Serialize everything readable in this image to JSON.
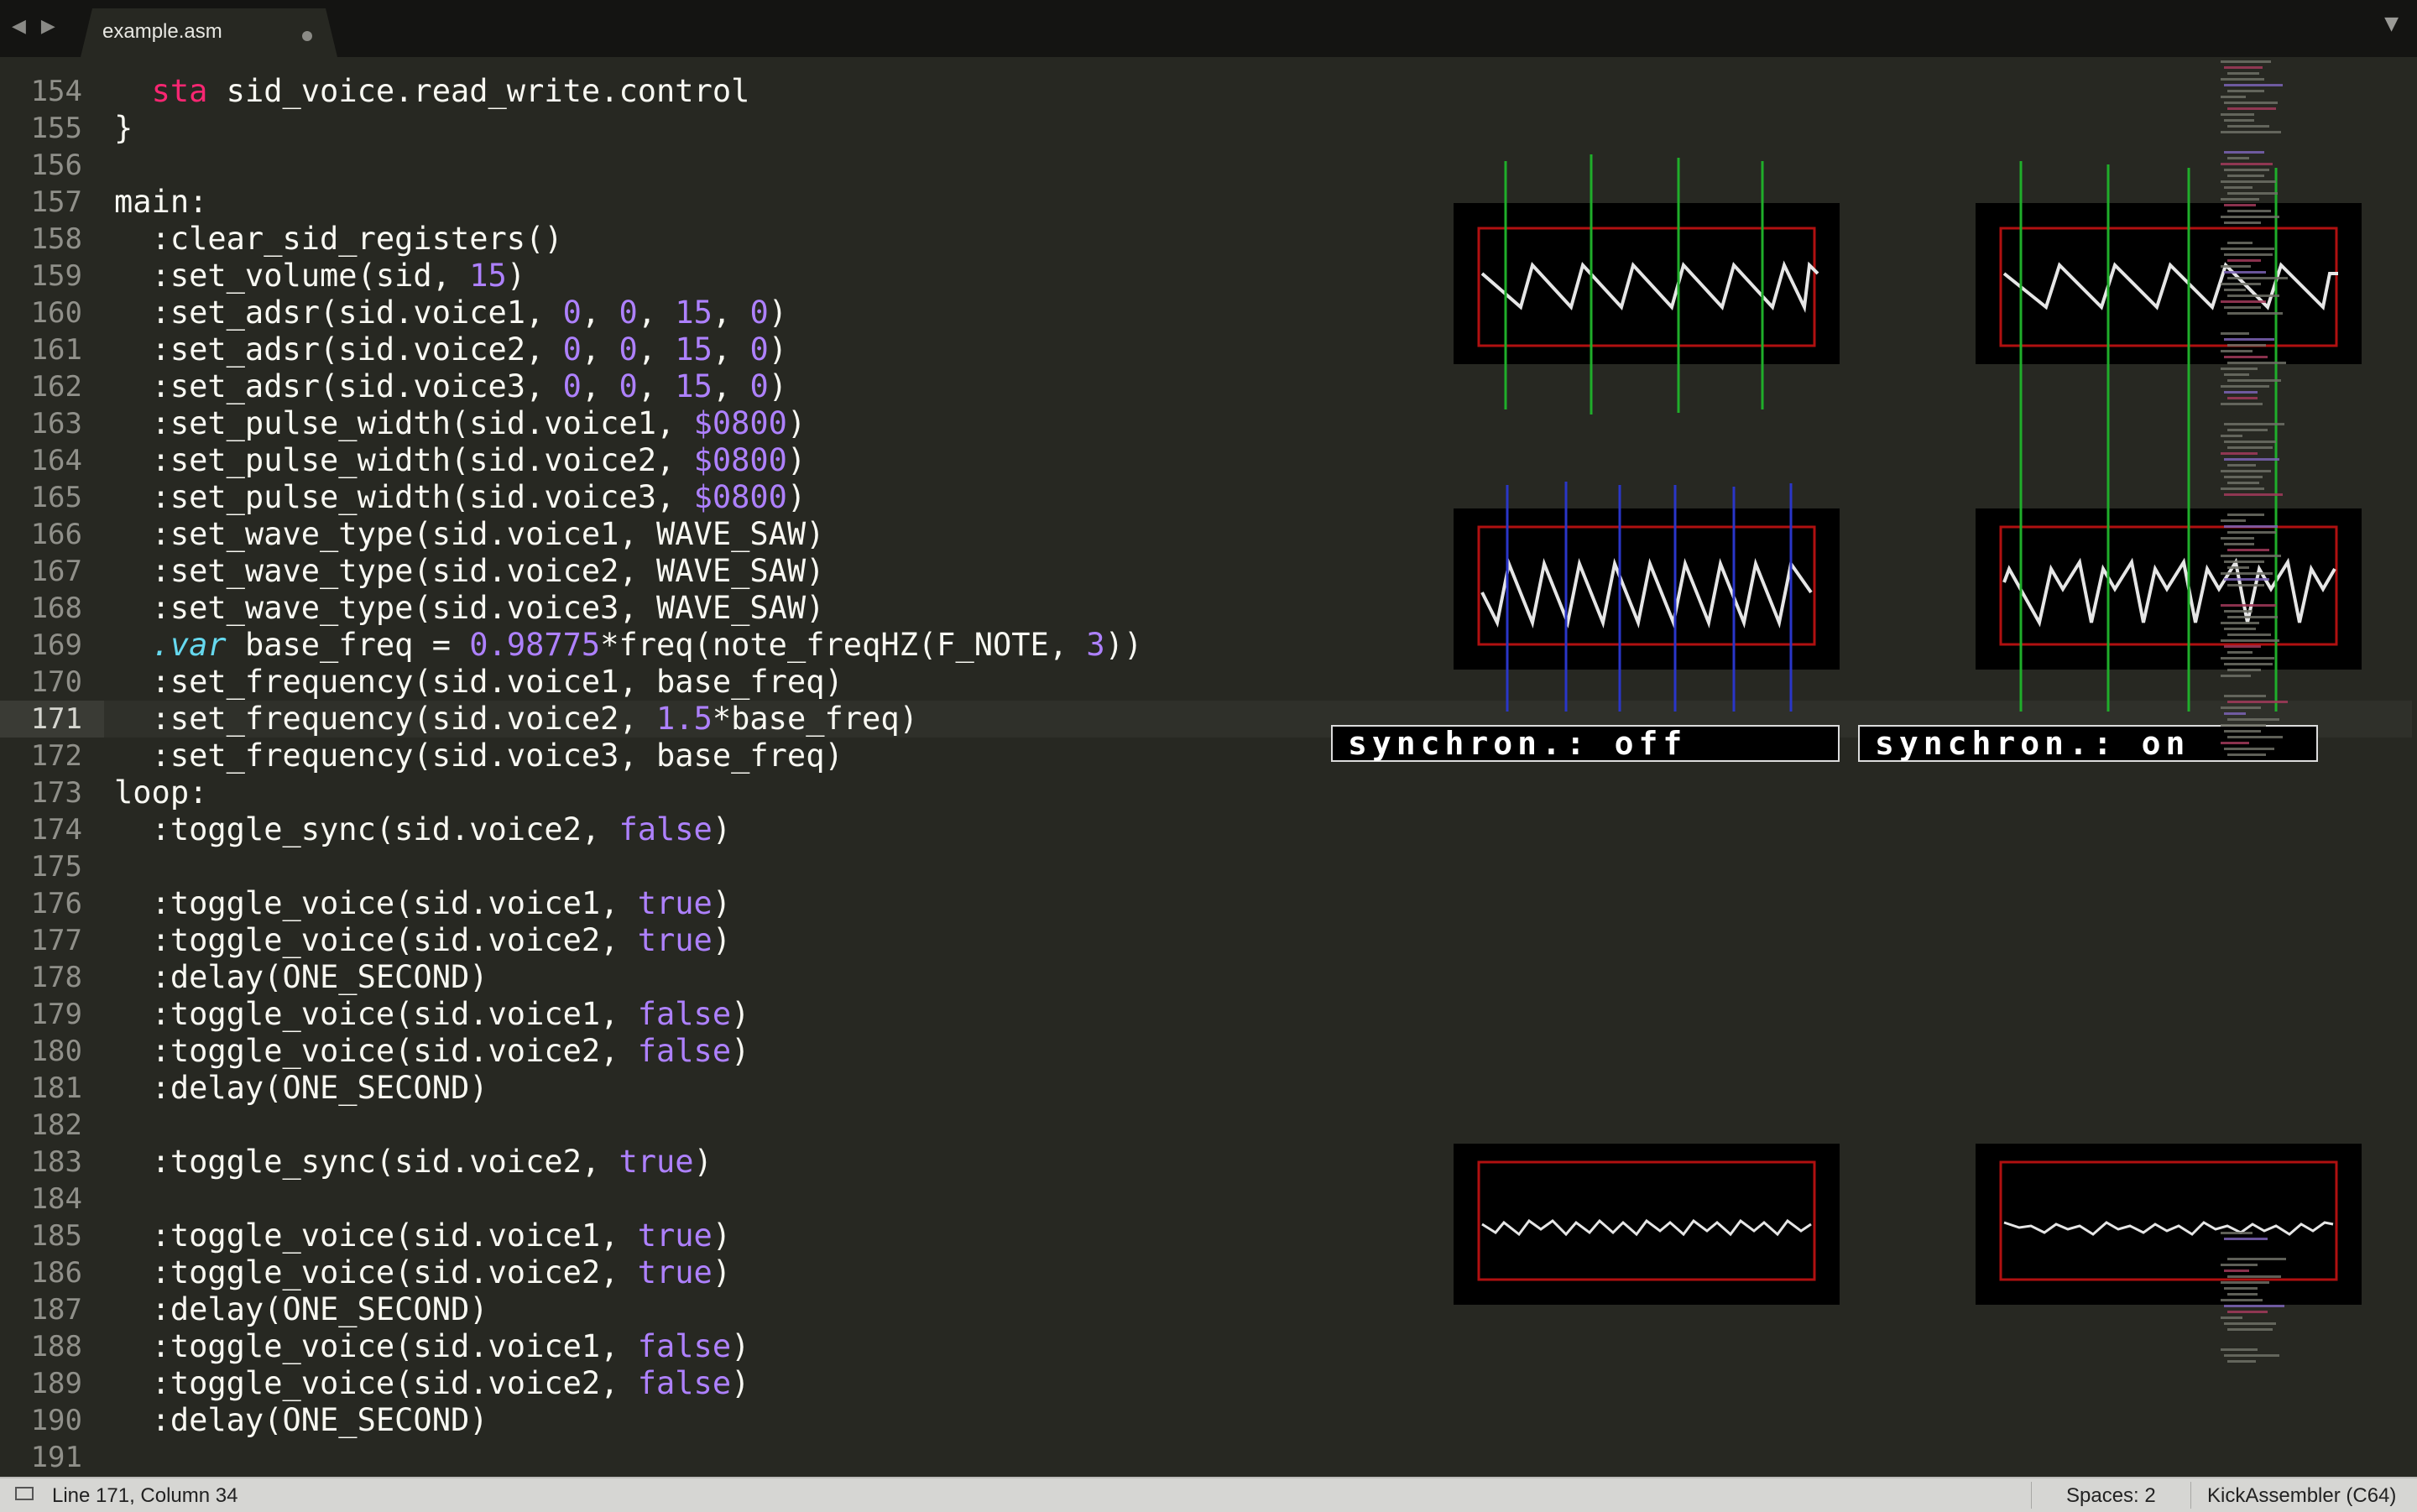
{
  "tab": {
    "title": "example.asm"
  },
  "nav": {
    "back": "◀",
    "forward": "▶",
    "menu": "▼"
  },
  "editor": {
    "lines": [
      {
        "n": "154",
        "segments": [
          {
            "t": "  "
          },
          {
            "t": "sta",
            "c": "k-red"
          },
          {
            "t": " sid_voice.read_write.control"
          }
        ]
      },
      {
        "n": "155",
        "segments": [
          {
            "t": "}"
          }
        ]
      },
      {
        "n": "156",
        "segments": [
          {
            "t": ""
          }
        ]
      },
      {
        "n": "157",
        "segments": [
          {
            "t": "main:"
          }
        ]
      },
      {
        "n": "158",
        "segments": [
          {
            "t": "  :clear_sid_registers()"
          }
        ]
      },
      {
        "n": "159",
        "segments": [
          {
            "t": "  :set_volume(sid, "
          },
          {
            "t": "15",
            "c": "k-num"
          },
          {
            "t": ")"
          }
        ]
      },
      {
        "n": "160",
        "segments": [
          {
            "t": "  :set_adsr(sid.voice1, "
          },
          {
            "t": "0",
            "c": "k-num"
          },
          {
            "t": ", "
          },
          {
            "t": "0",
            "c": "k-num"
          },
          {
            "t": ", "
          },
          {
            "t": "15",
            "c": "k-num"
          },
          {
            "t": ", "
          },
          {
            "t": "0",
            "c": "k-num"
          },
          {
            "t": ")"
          }
        ]
      },
      {
        "n": "161",
        "segments": [
          {
            "t": "  :set_adsr(sid.voice2, "
          },
          {
            "t": "0",
            "c": "k-num"
          },
          {
            "t": ", "
          },
          {
            "t": "0",
            "c": "k-num"
          },
          {
            "t": ", "
          },
          {
            "t": "15",
            "c": "k-num"
          },
          {
            "t": ", "
          },
          {
            "t": "0",
            "c": "k-num"
          },
          {
            "t": ")"
          }
        ]
      },
      {
        "n": "162",
        "segments": [
          {
            "t": "  :set_adsr(sid.voice3, "
          },
          {
            "t": "0",
            "c": "k-num"
          },
          {
            "t": ", "
          },
          {
            "t": "0",
            "c": "k-num"
          },
          {
            "t": ", "
          },
          {
            "t": "15",
            "c": "k-num"
          },
          {
            "t": ", "
          },
          {
            "t": "0",
            "c": "k-num"
          },
          {
            "t": ")"
          }
        ]
      },
      {
        "n": "163",
        "segments": [
          {
            "t": "  :set_pulse_width(sid.voice1, "
          },
          {
            "t": "$0800",
            "c": "k-num"
          },
          {
            "t": ")"
          }
        ]
      },
      {
        "n": "164",
        "segments": [
          {
            "t": "  :set_pulse_width(sid.voice2, "
          },
          {
            "t": "$0800",
            "c": "k-num"
          },
          {
            "t": ")"
          }
        ]
      },
      {
        "n": "165",
        "segments": [
          {
            "t": "  :set_pulse_width(sid.voice3, "
          },
          {
            "t": "$0800",
            "c": "k-num"
          },
          {
            "t": ")"
          }
        ]
      },
      {
        "n": "166",
        "segments": [
          {
            "t": "  :set_wave_type(sid.voice1, WAVE_SAW)"
          }
        ]
      },
      {
        "n": "167",
        "segments": [
          {
            "t": "  :set_wave_type(sid.voice2, WAVE_SAW)"
          }
        ]
      },
      {
        "n": "168",
        "segments": [
          {
            "t": "  :set_wave_type(sid.voice3, WAVE_SAW)"
          }
        ]
      },
      {
        "n": "169",
        "segments": [
          {
            "t": "  "
          },
          {
            "t": ".var",
            "c": "k-blue"
          },
          {
            "t": " base_freq = "
          },
          {
            "t": "0.98775",
            "c": "k-num"
          },
          {
            "t": "*freq(note_freqHZ(F_NOTE, "
          },
          {
            "t": "3",
            "c": "k-num"
          },
          {
            "t": "))"
          }
        ]
      },
      {
        "n": "170",
        "segments": [
          {
            "t": "  :set_frequency(sid.voice1, base_freq)"
          }
        ]
      },
      {
        "n": "171",
        "current": true,
        "segments": [
          {
            "t": "  :set_frequency(sid.voice2, "
          },
          {
            "t": "1.5",
            "c": "k-num"
          },
          {
            "t": "*base_freq)"
          }
        ]
      },
      {
        "n": "172",
        "segments": [
          {
            "t": "  :set_frequency(sid.voice3, base_freq)"
          }
        ]
      },
      {
        "n": "173",
        "segments": [
          {
            "t": "loop:"
          }
        ]
      },
      {
        "n": "174",
        "segments": [
          {
            "t": "  :toggle_sync(sid.voice2, "
          },
          {
            "t": "false",
            "c": "k-num"
          },
          {
            "t": ")"
          }
        ]
      },
      {
        "n": "175",
        "segments": [
          {
            "t": ""
          }
        ]
      },
      {
        "n": "176",
        "segments": [
          {
            "t": "  :toggle_voice(sid.voice1, "
          },
          {
            "t": "true",
            "c": "k-num"
          },
          {
            "t": ")"
          }
        ]
      },
      {
        "n": "177",
        "segments": [
          {
            "t": "  :toggle_voice(sid.voice2, "
          },
          {
            "t": "true",
            "c": "k-num"
          },
          {
            "t": ")"
          }
        ]
      },
      {
        "n": "178",
        "segments": [
          {
            "t": "  :delay(ONE_SECOND)"
          }
        ]
      },
      {
        "n": "179",
        "segments": [
          {
            "t": "  :toggle_voice(sid.voice1, "
          },
          {
            "t": "false",
            "c": "k-num"
          },
          {
            "t": ")"
          }
        ]
      },
      {
        "n": "180",
        "segments": [
          {
            "t": "  :toggle_voice(sid.voice2, "
          },
          {
            "t": "false",
            "c": "k-num"
          },
          {
            "t": ")"
          }
        ]
      },
      {
        "n": "181",
        "segments": [
          {
            "t": "  :delay(ONE_SECOND)"
          }
        ]
      },
      {
        "n": "182",
        "segments": [
          {
            "t": ""
          }
        ]
      },
      {
        "n": "183",
        "segments": [
          {
            "t": "  :toggle_sync(sid.voice2, "
          },
          {
            "t": "true",
            "c": "k-num"
          },
          {
            "t": ")"
          }
        ]
      },
      {
        "n": "184",
        "segments": [
          {
            "t": ""
          }
        ]
      },
      {
        "n": "185",
        "segments": [
          {
            "t": "  :toggle_voice(sid.voice1, "
          },
          {
            "t": "true",
            "c": "k-num"
          },
          {
            "t": ")"
          }
        ]
      },
      {
        "n": "186",
        "segments": [
          {
            "t": "  :toggle_voice(sid.voice2, "
          },
          {
            "t": "true",
            "c": "k-num"
          },
          {
            "t": ")"
          }
        ]
      },
      {
        "n": "187",
        "segments": [
          {
            "t": "  :delay(ONE_SECOND)"
          }
        ]
      },
      {
        "n": "188",
        "segments": [
          {
            "t": "  :toggle_voice(sid.voice1, "
          },
          {
            "t": "false",
            "c": "k-num"
          },
          {
            "t": ")"
          }
        ]
      },
      {
        "n": "189",
        "segments": [
          {
            "t": "  :toggle_voice(sid.voice2, "
          },
          {
            "t": "false",
            "c": "k-num"
          },
          {
            "t": ")"
          }
        ]
      },
      {
        "n": "190",
        "segments": [
          {
            "t": "  :delay(ONE_SECOND)"
          }
        ]
      },
      {
        "n": "191",
        "segments": [
          {
            "t": ""
          }
        ]
      }
    ]
  },
  "labels": {
    "sync_off": "synchron.: off",
    "sync_on": "synchron.: on"
  },
  "statusbar": {
    "position": "Line 171, Column 34",
    "spaces": "Spaces: 2",
    "syntax": "KickAssembler (C64)"
  },
  "colors": {
    "background": "#272822",
    "keyword": "#f92672",
    "number": "#ae81ff",
    "storage": "#66d9ef",
    "scope_frame": "#b01010",
    "sync_marker_green": "#1fae2a",
    "sync_marker_blue": "#2a36c8"
  }
}
